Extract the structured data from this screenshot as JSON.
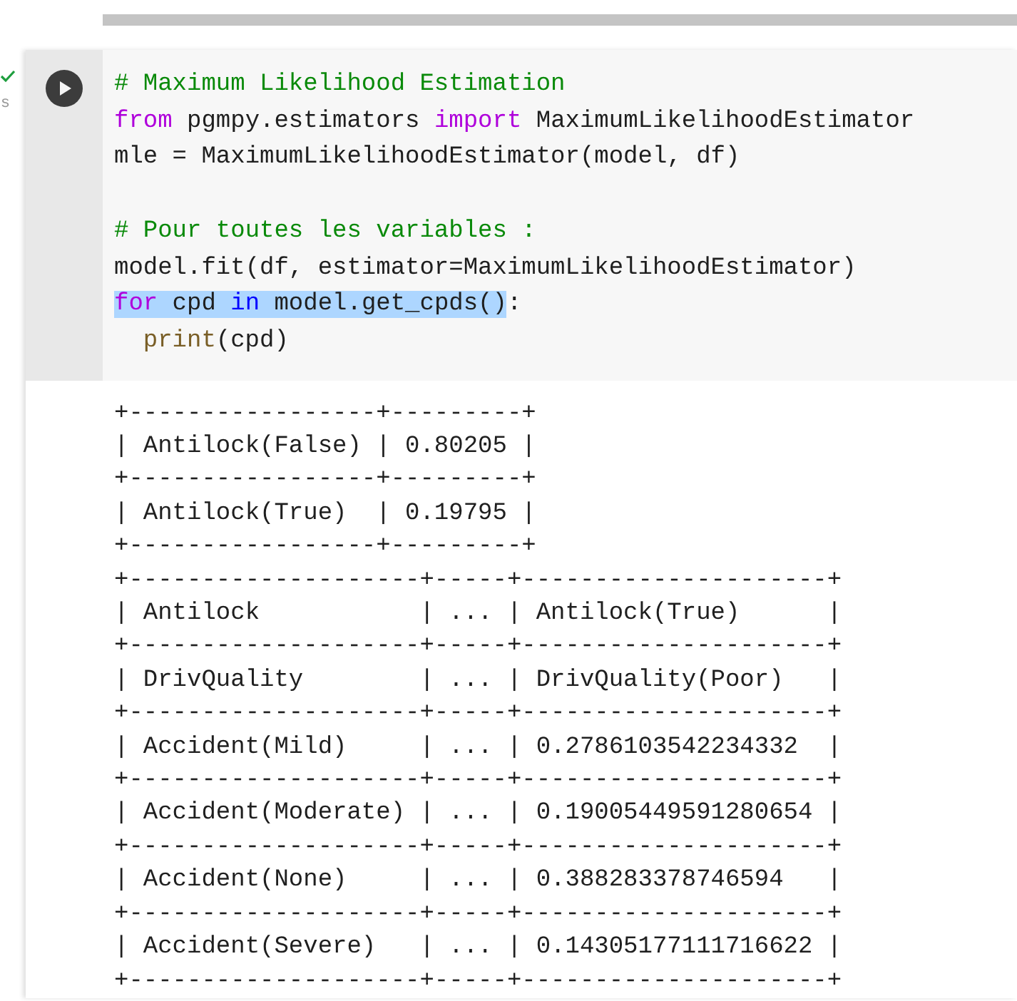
{
  "cell": {
    "exec_time": "s",
    "code_lines": [
      {
        "kind": "code",
        "indented": false,
        "tokens": [
          {
            "text": "# Maximum Likelihood Estimation",
            "kind": "comment",
            "selected": false
          }
        ]
      },
      {
        "kind": "code",
        "indented": false,
        "tokens": [
          {
            "text": "from",
            "kind": "keyword",
            "selected": false
          },
          {
            "text": " pgmpy.estimators ",
            "kind": "plain",
            "selected": false
          },
          {
            "text": "import",
            "kind": "keyword",
            "selected": false
          },
          {
            "text": " MaximumLikelihoodEstimator",
            "kind": "plain",
            "selected": false
          }
        ]
      },
      {
        "kind": "code",
        "indented": false,
        "tokens": [
          {
            "text": "mle = MaximumLikelihoodEstimator(model, df)",
            "kind": "plain",
            "selected": false
          }
        ]
      },
      {
        "kind": "blank"
      },
      {
        "kind": "code",
        "indented": false,
        "tokens": [
          {
            "text": "# Pour toutes les variables :",
            "kind": "comment",
            "selected": false
          }
        ]
      },
      {
        "kind": "code",
        "indented": false,
        "tokens": [
          {
            "text": "model.fit(df, estimator=MaximumLikelihoodEstimator)",
            "kind": "plain",
            "selected": false
          }
        ]
      },
      {
        "kind": "code",
        "indented": false,
        "tokens": [
          {
            "text": "for",
            "kind": "keyword",
            "selected": true
          },
          {
            "text": " cpd ",
            "kind": "plain",
            "selected": true
          },
          {
            "text": "in",
            "kind": "operator",
            "selected": true
          },
          {
            "text": " model.get_cpds()",
            "kind": "plain",
            "selected": true
          },
          {
            "text": ":",
            "kind": "plain",
            "selected": false
          }
        ]
      },
      {
        "kind": "code",
        "indented": true,
        "tokens": [
          {
            "text": "print",
            "kind": "builtin",
            "selected": false
          },
          {
            "text": "(cpd)",
            "kind": "plain",
            "selected": false
          }
        ]
      }
    ],
    "output": [
      "+-----------------+---------+",
      "| Antilock(False) | 0.80205 |",
      "+-----------------+---------+",
      "| Antilock(True)  | 0.19795 |",
      "+-----------------+---------+",
      "+--------------------+-----+---------------------+",
      "| Antilock           | ... | Antilock(True)      |",
      "+--------------------+-----+---------------------+",
      "| DrivQuality        | ... | DrivQuality(Poor)   |",
      "+--------------------+-----+---------------------+",
      "| Accident(Mild)     | ... | 0.2786103542234332  |",
      "+--------------------+-----+---------------------+",
      "| Accident(Moderate) | ... | 0.19005449591280654 |",
      "+--------------------+-----+---------------------+",
      "| Accident(None)     | ... | 0.388283378746594   |",
      "+--------------------+-----+---------------------+",
      "| Accident(Severe)   | ... | 0.14305177111716622 |",
      "+--------------------+-----+---------------------+"
    ]
  }
}
